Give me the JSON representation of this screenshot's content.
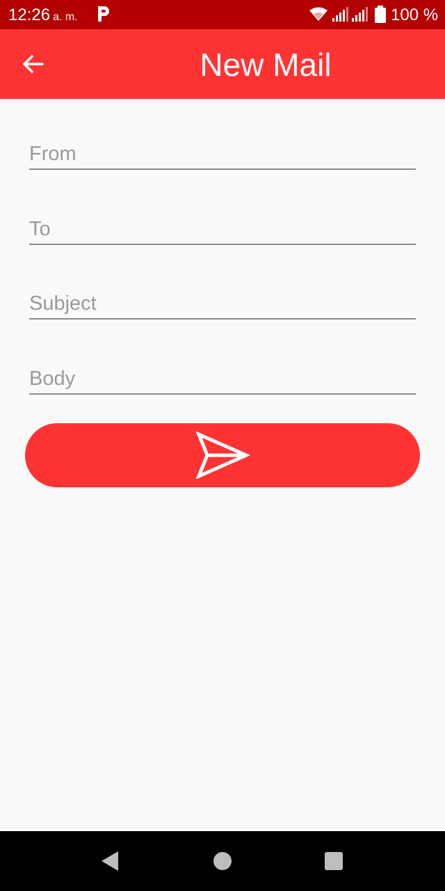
{
  "status_bar": {
    "time": "12:26",
    "ampm": "a. m.",
    "battery_percent": "100 %",
    "icons": [
      "p-icon",
      "wifi-icon",
      "signal-icon",
      "signal-icon",
      "battery-icon"
    ]
  },
  "app_bar": {
    "title": "New Mail",
    "back_icon": "arrow-left-icon",
    "background": "#ff3333"
  },
  "form": {
    "from": {
      "placeholder": "From",
      "value": ""
    },
    "to": {
      "placeholder": "To",
      "value": ""
    },
    "subject": {
      "placeholder": "Subject",
      "value": ""
    },
    "body": {
      "placeholder": "Body",
      "value": ""
    }
  },
  "send_button": {
    "icon": "send-icon",
    "background": "#ff3333"
  },
  "nav_bar": {
    "icons": [
      "nav-back-icon",
      "nav-home-icon",
      "nav-recents-icon"
    ]
  }
}
